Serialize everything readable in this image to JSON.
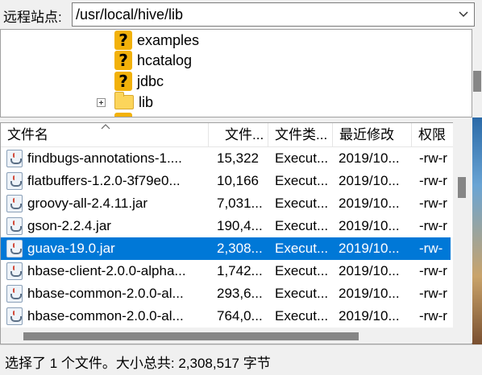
{
  "path_bar": {
    "label": "远程站点:",
    "value": "/usr/local/hive/lib"
  },
  "tree": {
    "items": [
      {
        "label": "examples",
        "icon": "question-icon"
      },
      {
        "label": "hcatalog",
        "icon": "question-icon"
      },
      {
        "label": "jdbc",
        "icon": "question-icon"
      },
      {
        "label": "lib",
        "icon": "folder-icon"
      }
    ]
  },
  "file_list": {
    "columns": [
      "文件名",
      "文件...",
      "文件类...",
      "最近修改",
      "权限"
    ],
    "rows": [
      {
        "name": "findbugs-annotations-1....",
        "size": "15,322",
        "type": "Execut...",
        "modified": "2019/10...",
        "perm": "-rw-r"
      },
      {
        "name": "flatbuffers-1.2.0-3f79e0...",
        "size": "10,166",
        "type": "Execut...",
        "modified": "2019/10...",
        "perm": "-rw-r"
      },
      {
        "name": "groovy-all-2.4.11.jar",
        "size": "7,031...",
        "type": "Execut...",
        "modified": "2019/10...",
        "perm": "-rw-r"
      },
      {
        "name": "gson-2.2.4.jar",
        "size": "190,4...",
        "type": "Execut...",
        "modified": "2019/10...",
        "perm": "-rw-r"
      },
      {
        "name": "guava-19.0.jar",
        "size": "2,308...",
        "type": "Execut...",
        "modified": "2019/10...",
        "perm": "-rw-"
      },
      {
        "name": "hbase-client-2.0.0-alpha...",
        "size": "1,742...",
        "type": "Execut...",
        "modified": "2019/10...",
        "perm": "-rw-r"
      },
      {
        "name": "hbase-common-2.0.0-al...",
        "size": "293,6...",
        "type": "Execut...",
        "modified": "2019/10...",
        "perm": "-rw-r"
      },
      {
        "name": "hbase-common-2.0.0-al...",
        "size": "764,0...",
        "type": "Execut...",
        "modified": "2019/10...",
        "perm": "-rw-r"
      }
    ],
    "selected_index": 4
  },
  "status": {
    "text": "选择了 1 个文件。大小总共: 2,308,517 字节"
  },
  "colors": {
    "selection": "#0078d7"
  }
}
